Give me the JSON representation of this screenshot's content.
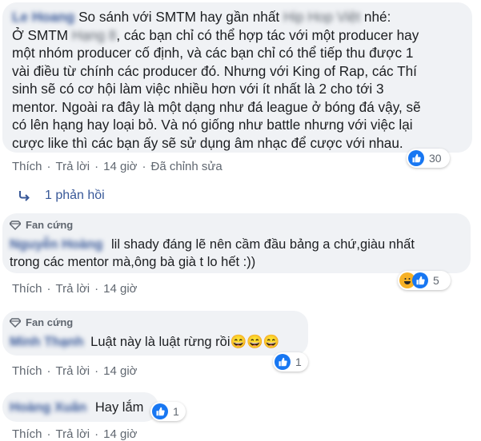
{
  "comment1": {
    "author": "Le Hoang",
    "lines": [
      "So sánh với SMTM hay gần nhất",
      "nhé:",
      "Ở SMTM",
      ", các bạn chỉ có thể hợp tác với một producer hay",
      "một nhóm producer cố định, và các bạn chỉ có thể tiếp thu được 1",
      "vài điều từ chính các producer đó. Nhưng với King of Rap, các Thí",
      "sinh sẽ có cơ hội làm việc nhiều hơn với ít nhất là 2 cho tới 3",
      "mentor. Ngoài ra đây là một dạng như đá league ở bóng đá vậy, sẽ",
      "có lên hạng hay loại bỏ. Và nó giống như battle nhưng với việc lại",
      "cược like thì các bạn ấy sẽ sử dụng âm nhạc để cược với nhau."
    ],
    "blur_a": "Hip Hop Việt",
    "blur_b": "Hạng 8",
    "reactions": "30",
    "actions": {
      "like": "Thích",
      "reply": "Trả lời",
      "time": "14 giờ",
      "edited": "Đã chỉnh sửa"
    }
  },
  "replies_toggle": "1 phản hồi",
  "comment2": {
    "badge": "Fan cứng",
    "author": "Nguyễn Hoàng",
    "line1": "lil shady đáng lẽ nên cầm đầu bảng a chứ,giàu nhất",
    "line2": "trong các mentor mà,ông bà già t lo hết :))",
    "reactions": "5",
    "actions": {
      "like": "Thích",
      "reply": "Trả lời",
      "time": "14 giờ"
    }
  },
  "comment3": {
    "badge": "Fan cứng",
    "author": "Minh Thạnh",
    "text": "Luật này là luật rừng rồi😄😄😄",
    "reactions": "1",
    "actions": {
      "like": "Thích",
      "reply": "Trả lời",
      "time": "14 giờ"
    }
  },
  "comment4": {
    "author": "Hoàng Xuân",
    "text": "Hay lắm",
    "reactions": "1",
    "actions": {
      "like": "Thích",
      "reply": "Trả lời",
      "time": "14 giờ"
    }
  },
  "colors": {
    "bubble": "#f0f2f5",
    "link": "#385898",
    "meta": "#606770",
    "like": "#1877f2",
    "haha": "#f7b125"
  }
}
